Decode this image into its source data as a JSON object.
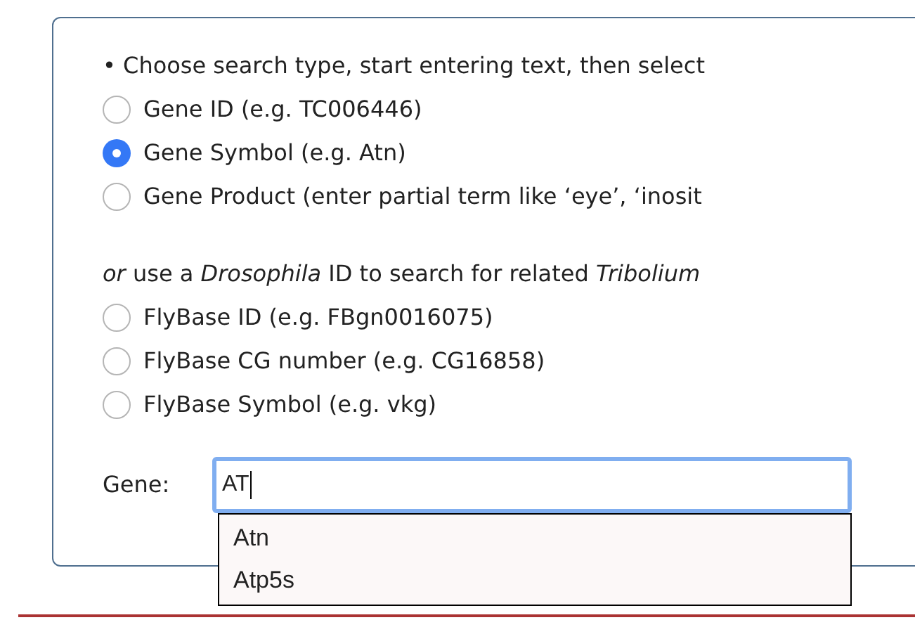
{
  "instruction": "• Choose search type, start entering text, then select",
  "search_types": [
    {
      "label": "Gene ID (e.g. TC006446)",
      "selected": false
    },
    {
      "label": "Gene Symbol (e.g. Atn)",
      "selected": true
    },
    {
      "label": "Gene Product (enter partial term like ‘eye’, ‘inosit",
      "selected": false
    }
  ],
  "alt_instruction": "*or* use a *Drosophila* ID to search for related *Tribolium*",
  "flybase_types": [
    {
      "label": "FlyBase ID (e.g. FBgn0016075)",
      "selected": false
    },
    {
      "label": "FlyBase CG number (e.g. CG16858)",
      "selected": false
    },
    {
      "label": "FlyBase Symbol (e.g. vkg)",
      "selected": false
    }
  ],
  "gene_field": {
    "label": "Gene:",
    "value": "AT",
    "focused": true
  },
  "suggestions": [
    "Atn",
    "Atp5s"
  ]
}
